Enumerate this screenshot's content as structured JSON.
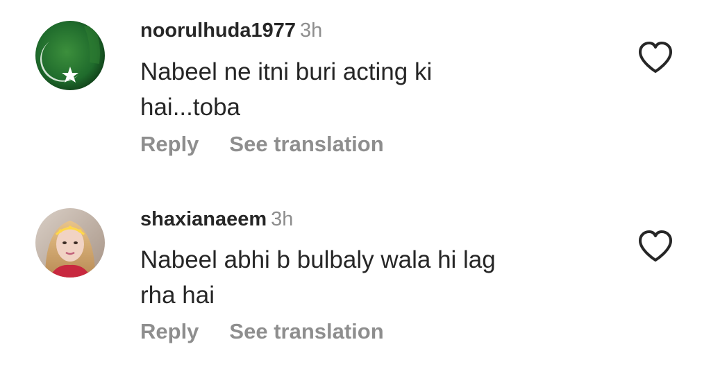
{
  "comments": [
    {
      "username": "noorulhuda1977",
      "time": "3h",
      "text": "Nabeel ne itni buri acting ki\nhai...toba",
      "reply_label": "Reply",
      "translate_label": "See translation",
      "avatar_icon": "pakistan-flag-avatar",
      "like_icon": "heart-outline-icon"
    },
    {
      "username": "shaxianaeem",
      "time": "3h",
      "text": "Nabeel abhi b bulbaly wala hi lag\nrha hai",
      "reply_label": "Reply",
      "translate_label": "See translation",
      "avatar_icon": "user-photo-avatar",
      "like_icon": "heart-outline-icon"
    }
  ],
  "colors": {
    "primary_text": "#262626",
    "secondary_text": "#8e8e8e",
    "flag_green": "#1f6b2c"
  }
}
